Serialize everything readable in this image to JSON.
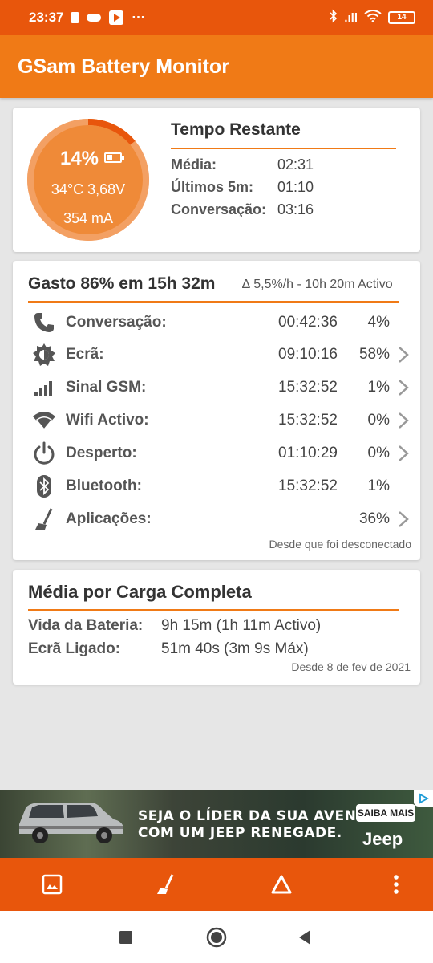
{
  "status_bar": {
    "time": "23:37",
    "dots": "···",
    "signal_text": ".ıll",
    "battery_level": "14"
  },
  "app_bar": {
    "title": "GSam Battery Monitor"
  },
  "summary": {
    "percent": "14%",
    "temp_voltage": "34°C  3,68V",
    "current": "354 mA",
    "charge_fraction": 0.14,
    "remaining_title": "Tempo Restante",
    "rows": [
      {
        "label": "Média:",
        "value": "02:31"
      },
      {
        "label": "Últimos 5m:",
        "value": "01:10"
      },
      {
        "label": "Conversação:",
        "value": "03:16"
      }
    ]
  },
  "usage": {
    "title": "Gasto 86% em 15h 32m",
    "rate": "∆ 5,5%/h - 10h 20m Activo",
    "rows": [
      {
        "icon": "phone-icon",
        "name": "Conversação:",
        "time": "00:42:36",
        "pct": "4%",
        "chevron": false
      },
      {
        "icon": "brightness-icon",
        "name": "Ecrã:",
        "time": "09:10:16",
        "pct": "58%",
        "chevron": true
      },
      {
        "icon": "signal-icon",
        "name": "Sinal GSM:",
        "time": "15:32:52",
        "pct": "1%",
        "chevron": true
      },
      {
        "icon": "wifi-icon",
        "name": "Wifi Activo:",
        "time": "15:32:52",
        "pct": "0%",
        "chevron": true
      },
      {
        "icon": "power-icon",
        "name": "Desperto:",
        "time": "01:10:29",
        "pct": "0%",
        "chevron": true
      },
      {
        "icon": "bluetooth-icon",
        "name": "Bluetooth:",
        "time": "15:32:52",
        "pct": "1%",
        "chevron": false
      },
      {
        "icon": "broom-icon",
        "name": "Aplicações:",
        "time": "",
        "pct": "36%",
        "chevron": true
      }
    ],
    "since": "Desde que foi desconectado"
  },
  "average": {
    "title": "Média por Carga Completa",
    "rows": [
      {
        "label": "Vida da Bateria:",
        "value": "9h 15m (1h 11m Activo)"
      },
      {
        "label": "Ecrã Ligado:",
        "value": "51m 40s (3m 9s Máx)"
      }
    ],
    "since": "Desde 8 de fev de 2021"
  },
  "ad": {
    "line1": "SEJA O LÍDER DA SUA AVENTURA",
    "line2": "COM UM JEEP RENEGADE.",
    "button": "SAIBA MAIS",
    "brand": "Jeep"
  },
  "toolbar": {
    "icons": [
      "image-icon",
      "broom-icon",
      "delta-icon",
      "more-vert-icon"
    ]
  },
  "nav": {
    "icons": [
      "recents-square-icon",
      "home-circle-icon",
      "back-triangle-icon"
    ]
  },
  "colors": {
    "status_bar": "#e8560c",
    "app_bar": "#f07a16",
    "accent": "#f07a16",
    "gauge": "#ef8a38"
  }
}
